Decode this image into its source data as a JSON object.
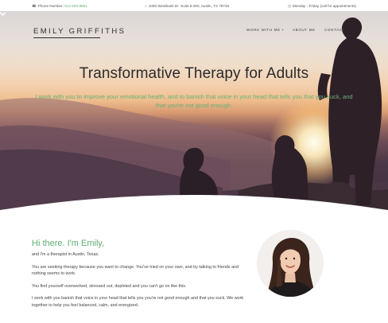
{
  "topbar": {
    "phone_label": "Phone Number:",
    "phone_number": "512-294-9861",
    "address": "1000 Westbank Dr. Suite 6-250, Austin, TX 78746",
    "hours": "Monday - Friday (call for appointments)",
    "icons": [
      "phone-icon",
      "home-icon",
      "clock-icon"
    ]
  },
  "header": {
    "logo": "EMILY GRIFFITHS",
    "nav": [
      "WORK WITH ME +",
      "ABOUT ME",
      "CONTACT"
    ]
  },
  "hero": {
    "title": "Transformative Therapy for Adults",
    "subtitle": "I work with you to improve your emotional health, and to banish that voice in your head that tells you that you suck, and that you're not good enough.",
    "scroll_icon": "chevron-down-icon"
  },
  "intro": {
    "heading": "Hi there. I'm Emily,",
    "paragraphs": [
      "and I'm a therapist in Austin, Texas.",
      "You are seeking therapy because you want to change. You've tried on your own, and by talking to friends and nothing seems to work.",
      "You find yourself overworked, stressed out, depleted and you can't go on like this.",
      "I work with you banish that voice in your head that tells you you're not good enough and that you suck. We work together to help you feel balanced, calm, and energized."
    ]
  },
  "colors": {
    "accent_green": "#5fae6f",
    "text_dark": "#2b2b2b"
  }
}
